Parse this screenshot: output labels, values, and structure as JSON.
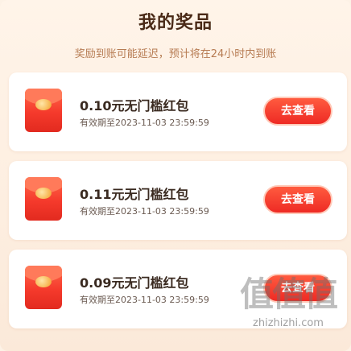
{
  "header": {
    "title": "我的奖品",
    "subtitle": "奖励到账可能延迟，预计将在24小时内到账"
  },
  "prizes": [
    {
      "name": "0.10元无门槛红包",
      "expiry": "有效期至2023-11-03 23:59:59",
      "action_label": "去查看"
    },
    {
      "name": "0.11元无门槛红包",
      "expiry": "有效期至2023-11-03 23:59:59",
      "action_label": "去查看"
    },
    {
      "name": "0.09元无门槛红包",
      "expiry": "有效期至2023-11-03 23:59:59",
      "action_label": "去查看"
    }
  ],
  "watermark": {
    "glyphs": "值值值",
    "site": "zhizhizhi.com"
  },
  "colors": {
    "accent": "#ee2a24",
    "background": "#fdeee0",
    "title": "#4a2a17",
    "subtitle": "#b67b52"
  }
}
